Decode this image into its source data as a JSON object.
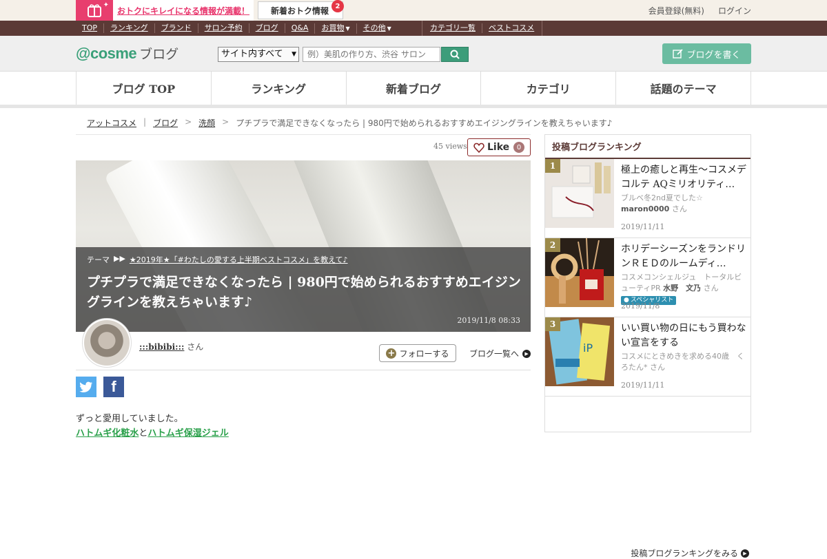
{
  "topbar": {
    "promo_text": "おトクにキレイになる情報が満載！",
    "news_label": "新着おトク情報",
    "news_count": "2",
    "register": "会員登録(無料)",
    "login": "ログイン"
  },
  "nav": {
    "items": [
      "TOP",
      "ランキング",
      "ブランド",
      "サロン予約",
      "ブログ",
      "Q&A",
      "お買物",
      "その他"
    ],
    "items_right": [
      "カテゴリ一覧",
      "ベストコスメ"
    ]
  },
  "header": {
    "logo_main": "@cosme",
    "logo_sub": "ブログ",
    "search_scope": "サイト内すべて",
    "search_placeholder": "例）美肌の作り方、渋谷 サロン",
    "write_label": "ブログを書く"
  },
  "tabs": [
    "ブログ TOP",
    "ランキング",
    "新着ブログ",
    "カテゴリ",
    "話題のテーマ"
  ],
  "breadcrumb": {
    "items": [
      "アットコスメ",
      "ブログ",
      "洗顔"
    ],
    "current": "プチプラで満足できなくなったら | 980円で始められるおすすめエイジングラインを教えちゃいます♪"
  },
  "article": {
    "views": "45 views",
    "like_label": "Like",
    "like_count": "0",
    "theme_label": "テーマ",
    "theme_link": "★2019年★「#わたしの愛する上半期ベストコスメ」を教えて♪",
    "title": "プチプラで満足できなくなったら | 980円で始められるおすすめエイジングラインを教えちゃいます♪",
    "date": "2019/11/8 08:33",
    "author_name": ":::bibibi:::",
    "author_suffix": "さん",
    "follow_label": "フォローする",
    "bloglist_label": "ブログ一覧へ",
    "body_line1": "ずっと愛用していました。",
    "body_link1": "ハトムギ化粧水",
    "body_and": "と",
    "body_link2": "ハトムギ保湿ジェル"
  },
  "sidebar": {
    "heading": "投稿ブログランキング",
    "ranks": [
      {
        "num": "1",
        "title": "極上の癒しと再生～コスメデコルテ AQミリオリティ…",
        "by": "ブルベ冬2nd夏でした☆",
        "user": "maron0000",
        "suffix": "さん",
        "date": "2019/11/11"
      },
      {
        "num": "2",
        "title": "ホリデーシーズンをランドリンＲＥＤのルームディ…",
        "by": "コスメコンシェルジュ　トータルビューティPR",
        "user": "水野　文乃",
        "suffix": "さん",
        "badge": "スペシャリスト",
        "date": "2019/11/8"
      },
      {
        "num": "3",
        "title": "いい買い物の日にもう買わない宣言をする",
        "by": "コスメにときめきを求める40歳　くろたん*",
        "user": "",
        "suffix": "さん",
        "date": "2019/11/11"
      }
    ],
    "more_label": "投稿ブログランキングをみる"
  },
  "colors": {
    "brand_green": "#3aa079",
    "nav_brown": "#5b3a36",
    "promo_pink": "#e8336b"
  }
}
